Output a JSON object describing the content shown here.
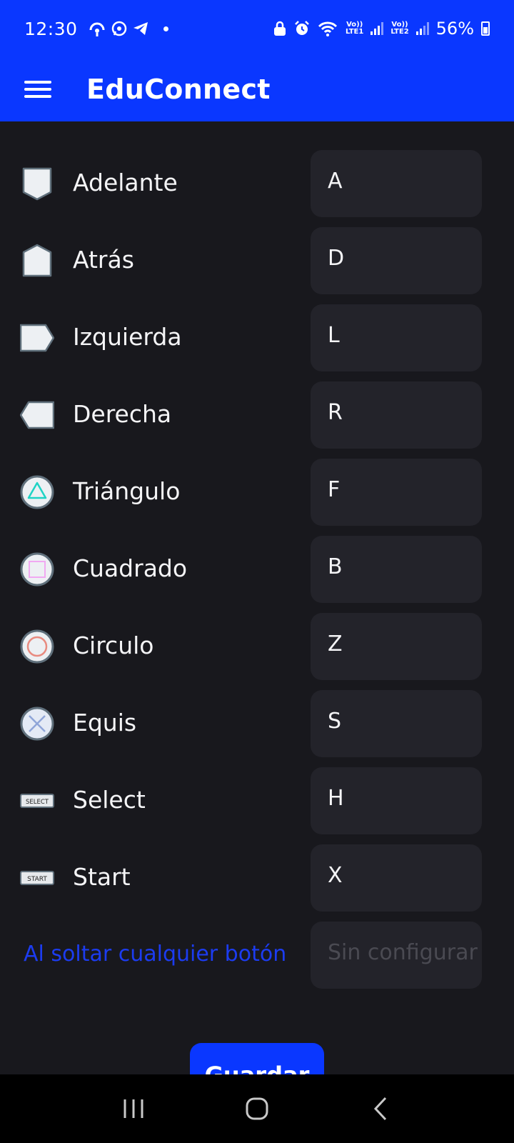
{
  "status_bar": {
    "time": "12:30",
    "volte1": "Vo))",
    "lte1": "LTE1",
    "volte2": "Vo))",
    "lte2": "LTE2",
    "battery": "56%",
    "icons": [
      "hotspot-icon",
      "whatsapp-icon",
      "telegram-icon",
      "dot-icon",
      "lock-icon",
      "alarm-icon",
      "wifi-icon",
      "signal-icon",
      "battery-icon"
    ]
  },
  "app_bar": {
    "title": "EduConnect",
    "menu_icon": "hamburger-menu-icon"
  },
  "mappings": [
    {
      "label": "Adelante",
      "key": "A",
      "icon": "dpad-up-icon"
    },
    {
      "label": "Atrás",
      "key": "D",
      "icon": "dpad-down-icon"
    },
    {
      "label": "Izquierda",
      "key": "L",
      "icon": "dpad-left-icon"
    },
    {
      "label": "Derecha",
      "key": "R",
      "icon": "dpad-right-icon"
    },
    {
      "label": "Triángulo",
      "key": "F",
      "icon": "triangle-button-icon"
    },
    {
      "label": "Cuadrado",
      "key": "B",
      "icon": "square-button-icon"
    },
    {
      "label": "Circulo",
      "key": "Z",
      "icon": "circle-button-icon"
    },
    {
      "label": "Equis",
      "key": "S",
      "icon": "cross-button-icon"
    },
    {
      "label": "Select",
      "key": "H",
      "icon": "select-button-icon",
      "icon_text": "SELECT"
    },
    {
      "label": "Start",
      "key": "X",
      "icon": "start-button-icon",
      "icon_text": "START"
    }
  ],
  "release": {
    "label": "Al soltar cualquier botón",
    "placeholder": "Sin configurar"
  },
  "save_label": "Guardar",
  "colors": {
    "accent": "#0a37ff",
    "background": "#18181d",
    "field": "#23232a",
    "release_text": "#1c3cf0"
  },
  "nav_bar": [
    "recents-icon",
    "home-icon",
    "back-icon"
  ]
}
